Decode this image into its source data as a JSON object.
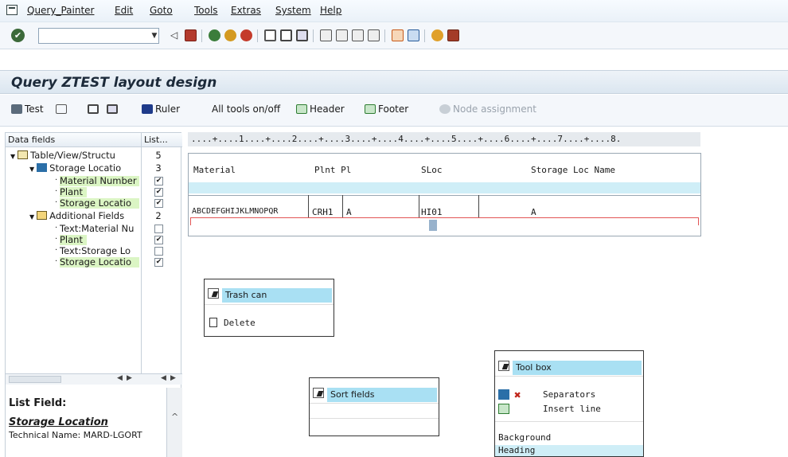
{
  "menu": {
    "items": [
      "Query_Painter",
      "Edit",
      "Goto",
      "Tools",
      "Extras",
      "System",
      "Help"
    ]
  },
  "std_toolbar": {
    "command_value": "",
    "icons": [
      "enter-icon",
      "back-icon",
      "save-icon",
      "back-green-icon",
      "exit-icon",
      "cancel-icon",
      "print-icon",
      "find-icon",
      "find-next-icon",
      "first-page-icon",
      "previous-page-icon",
      "next-page-icon",
      "last-page-icon",
      "create-session-icon",
      "shortcut-icon",
      "help-icon",
      "customize-layout-icon"
    ]
  },
  "title": "Query ZTEST layout design",
  "app_toolbar": {
    "test": "Test",
    "ruler": "Ruler",
    "all_tools": "All tools on/off",
    "header": "Header",
    "footer": "Footer",
    "node_assignment": "Node assignment"
  },
  "left_panel": {
    "col_data_fields": "Data fields",
    "col_list": "List...",
    "tree": [
      {
        "label": "Table/View/Structu",
        "value": "5",
        "level": 0,
        "type": "folder"
      },
      {
        "label": "Storage Locatio",
        "value": "3",
        "level": 1,
        "type": "table"
      },
      {
        "label": "Material Number",
        "checked": true,
        "level": 2,
        "highlight": true
      },
      {
        "label": "Plant",
        "checked": true,
        "level": 2,
        "highlight": true
      },
      {
        "label": "Storage Locatio",
        "checked": true,
        "level": 2,
        "highlight": true
      },
      {
        "label": "Additional Fields",
        "value": "2",
        "level": 1,
        "type": "extra"
      },
      {
        "label": "Text:Material Nu",
        "checked": false,
        "level": 2,
        "highlight": false
      },
      {
        "label": "Plant",
        "checked": true,
        "level": 2,
        "highlight": true
      },
      {
        "label": "Text:Storage Lo",
        "checked": false,
        "level": 2,
        "highlight": false
      },
      {
        "label": "Storage Locatio",
        "checked": true,
        "level": 2,
        "highlight": true
      }
    ],
    "list_field_label": "List Field:",
    "field_name": "Storage Location",
    "technical_name": "Technical Name: MARD-LGORT"
  },
  "ruler_text": "....+....1....+....2....+....3....+....4....+....5....+....6....+....7....+....8.",
  "output": {
    "headers": [
      "Material",
      "Plnt Pl",
      "SLoc",
      "Storage Loc Name"
    ],
    "cells": [
      "ABCDEFGHIJKLMNOPQR",
      "CRH1",
      "A",
      "HI01",
      "A"
    ]
  },
  "trash_box": {
    "title": "Trash can",
    "delete": "Delete"
  },
  "sort_box": {
    "title": "Sort fields"
  },
  "tool_box": {
    "title": "Tool box",
    "separators": "Separators",
    "insert_line": "Insert line",
    "background": "Background",
    "heading": "Heading"
  }
}
